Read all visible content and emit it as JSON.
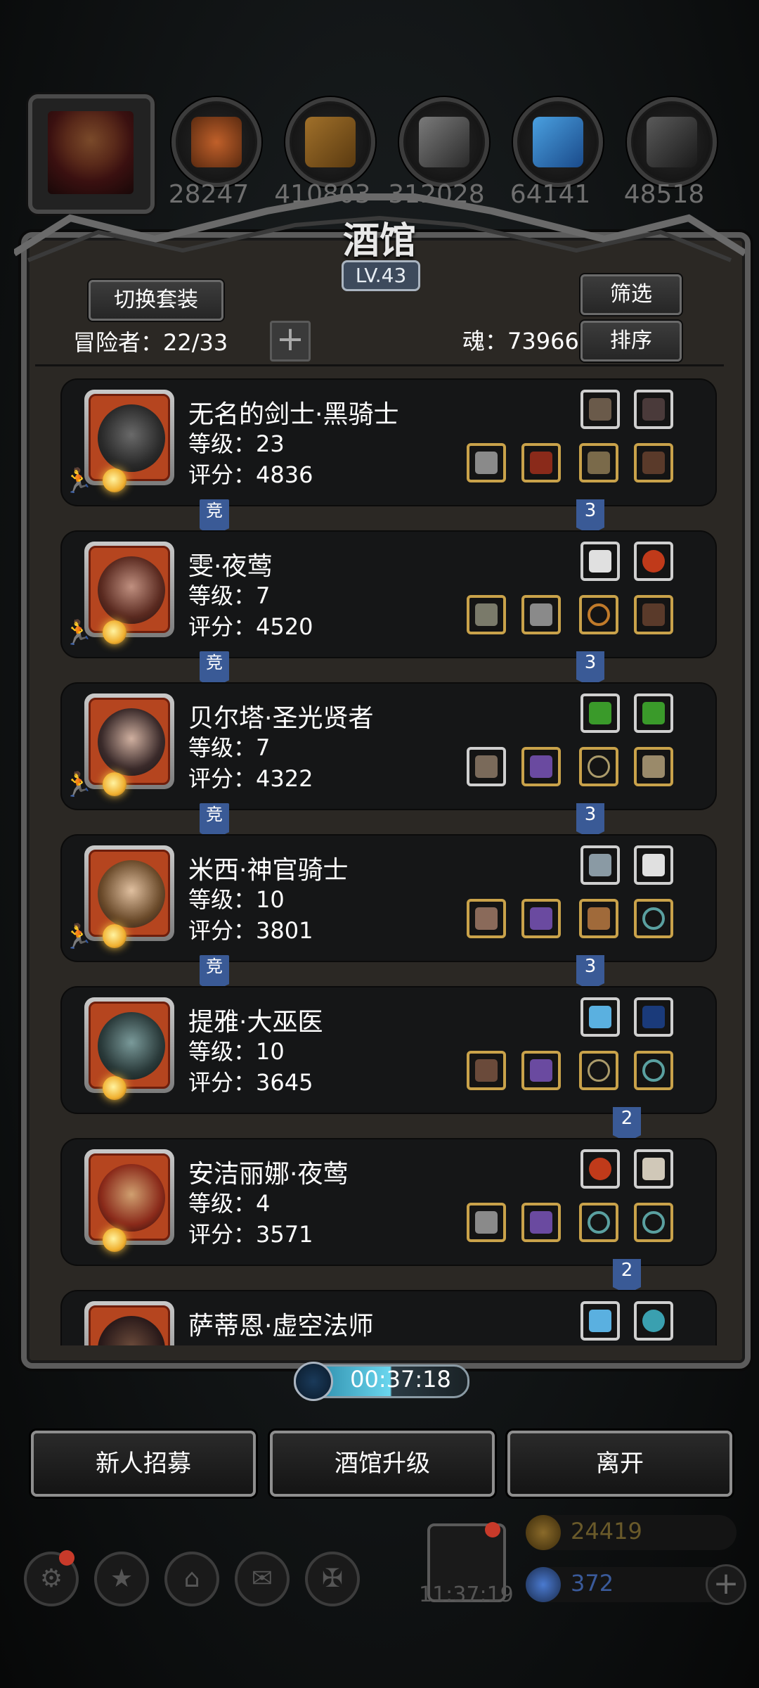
{
  "header": {
    "resources": [
      {
        "icon": "coin-bag-icon",
        "value": "28247"
      },
      {
        "icon": "wood-plank-icon",
        "value": "410803"
      },
      {
        "icon": "iron-ingot-icon",
        "value": "312028"
      },
      {
        "icon": "blue-crystal-icon",
        "value": "64141"
      },
      {
        "icon": "steel-ingot-icon",
        "value": "48518"
      }
    ]
  },
  "tavern": {
    "title": "酒馆",
    "level": "LV.43",
    "switch_outfit_label": "切换套装",
    "filter_label": "筛选",
    "sort_label": "排序",
    "adventurers_label": "冒险者：22/33",
    "souls_label": "魂：73966"
  },
  "heroes": [
    {
      "name": "无名的剑士·黑骑士",
      "level": "等级：23",
      "score": "评分：4836",
      "tag_left": "竞",
      "tag_right": "3",
      "slots_top": [
        {
          "icon": "crossbow-icon"
        },
        {
          "icon": "black-feather-icon"
        }
      ],
      "slots_bottom": [
        {
          "icon": "sword-icon"
        },
        {
          "icon": "red-helmet-icon"
        },
        {
          "icon": "bronze-armor-icon"
        },
        {
          "icon": "leather-boots-icon"
        }
      ]
    },
    {
      "name": "雯·夜莺",
      "level": "等级：7",
      "score": "评分：4520",
      "tag_left": "竞",
      "tag_right": "3",
      "slots_top": [
        {
          "icon": "white-feather-icon"
        },
        {
          "icon": "red-gem-icon"
        }
      ],
      "slots_bottom": [
        {
          "icon": "spear-icon"
        },
        {
          "icon": "chest-armor-icon"
        },
        {
          "icon": "gold-ring-icon"
        },
        {
          "icon": "leather-boots-icon"
        }
      ]
    },
    {
      "name": "贝尔塔·圣光贤者",
      "level": "等级：7",
      "score": "评分：4322",
      "tag_left": "竞",
      "tag_right": "3",
      "slots_top": [
        {
          "icon": "green-scroll-icon"
        },
        {
          "icon": "green-scroll-icon"
        }
      ],
      "slots_bottom": [
        {
          "icon": "hammer-icon"
        },
        {
          "icon": "purple-armor-icon"
        },
        {
          "icon": "necklace-icon"
        },
        {
          "icon": "gauntlet-icon"
        }
      ]
    },
    {
      "name": "米西·神官骑士",
      "level": "等级：10",
      "score": "评分：3801",
      "tag_left": "竞",
      "tag_right": "3",
      "slots_top": [
        {
          "icon": "grey-book-icon"
        },
        {
          "icon": "white-wing-icon"
        }
      ],
      "slots_bottom": [
        {
          "icon": "axe-icon"
        },
        {
          "icon": "purple-armor-icon"
        },
        {
          "icon": "boots-icon"
        },
        {
          "icon": "jade-ring-icon"
        }
      ]
    },
    {
      "name": "提雅·大巫医",
      "level": "等级：10",
      "score": "评分：3645",
      "tag_left": "",
      "tag_right": "2",
      "slots_top": [
        {
          "icon": "blue-gauntlet-icon"
        },
        {
          "icon": "blue-bow-icon"
        }
      ],
      "slots_bottom": [
        {
          "icon": "staff-icon"
        },
        {
          "icon": "purple-armor-icon"
        },
        {
          "icon": "necklace-icon"
        },
        {
          "icon": "jade-ring-icon"
        }
      ]
    },
    {
      "name": "安洁丽娜·夜莺",
      "level": "等级：4",
      "score": "评分：3571",
      "tag_left": "",
      "tag_right": "2",
      "slots_top": [
        {
          "icon": "red-gem-icon"
        },
        {
          "icon": "white-claw-icon"
        }
      ],
      "slots_bottom": [
        {
          "icon": "sword-icon"
        },
        {
          "icon": "purple-armor-icon"
        },
        {
          "icon": "jade-ring-icon"
        },
        {
          "icon": "jade-ring-icon"
        }
      ]
    },
    {
      "name": "萨蒂恩·虚空法师",
      "level": "",
      "score": "",
      "tag_left": "",
      "tag_right": "",
      "slots_top": [
        {
          "icon": "blue-gauntlet-icon"
        },
        {
          "icon": "blue-bracelet-icon"
        }
      ],
      "slots_bottom": []
    }
  ],
  "timer": {
    "value": "00:37:18"
  },
  "actions": {
    "recruit_label": "新人招募",
    "upgrade_label": "酒馆升级",
    "leave_label": "离开"
  },
  "footer": {
    "gift_timer": "11:37:19",
    "gold_value": "24419",
    "gem_value": "372"
  },
  "colors": {
    "panel": "#2b2824",
    "card": "#151617",
    "tag_blue": "#3a5a96",
    "timer_cyan": "#6ad6ee",
    "gold_text": "#7a6a2a",
    "gem_text": "#4a7ad0"
  }
}
